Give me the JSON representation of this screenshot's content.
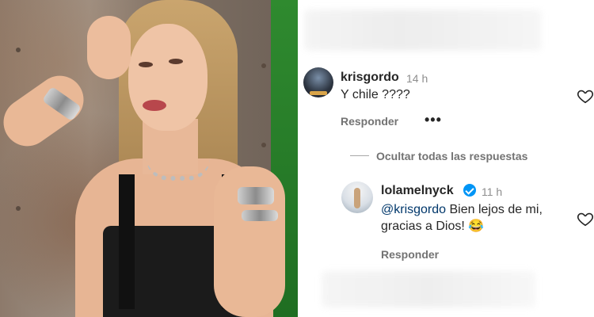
{
  "comments": [
    {
      "username": "krisgordo",
      "time": "14 h",
      "text": "Y chile ????",
      "reply_label": "Responder",
      "more_label": "•••"
    }
  ],
  "thread": {
    "hide_replies_label": "Ocultar todas las respuestas"
  },
  "replies": [
    {
      "username": "lolamelnyck",
      "time": "11 h",
      "verified": true,
      "mention": "@krisgordo",
      "text_line1": " Bien lejos de mi,",
      "text_line2": "gracias a Dios! ",
      "emoji": "😂",
      "reply_label": "Responder"
    }
  ],
  "icons": {
    "like": "heart-icon",
    "verified": "verified-badge-icon"
  },
  "colors": {
    "text": "#262626",
    "secondary": "#8e8e8e",
    "mention": "#00376b",
    "verified": "#0095f6"
  }
}
